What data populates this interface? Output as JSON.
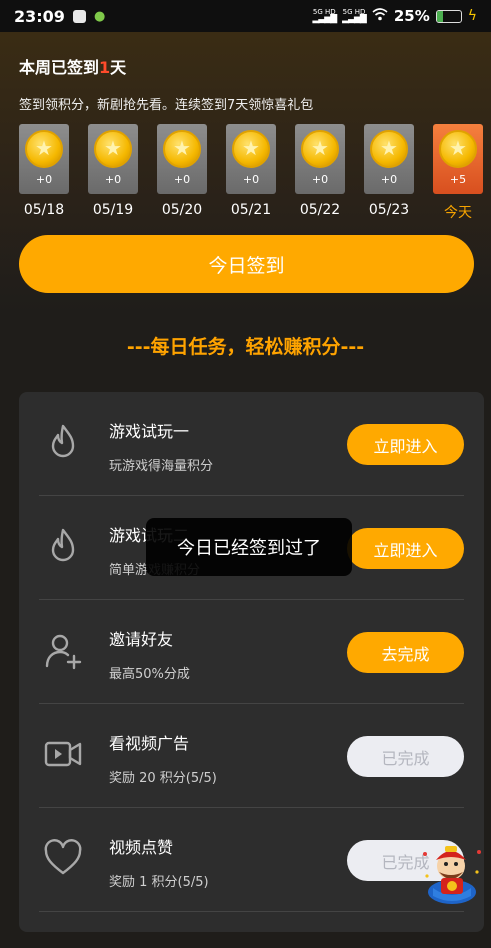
{
  "status_bar": {
    "time": "23:09",
    "signal_1_label": "5G HD",
    "signal_2_label": "5G HD",
    "battery_percent": "25%",
    "battery_level": 0.25
  },
  "week": {
    "title_prefix": "本周已签到",
    "days_count": "1",
    "title_suffix": "天",
    "subtitle": "签到领积分，新剧抢先看。连续签到7天领惊喜礼包"
  },
  "days": [
    {
      "points": "+0",
      "date": "05/18"
    },
    {
      "points": "+0",
      "date": "05/19"
    },
    {
      "points": "+0",
      "date": "05/20"
    },
    {
      "points": "+0",
      "date": "05/21"
    },
    {
      "points": "+0",
      "date": "05/22"
    },
    {
      "points": "+0",
      "date": "05/23"
    },
    {
      "points": "+5",
      "date": "今天"
    }
  ],
  "checkin_button": "今日签到",
  "tasks_heading": "---每日任务，轻松赚积分---",
  "tasks": [
    {
      "icon": "flame-icon",
      "title": "游戏试玩一",
      "desc": "玩游戏得海量积分",
      "button": "立即进入",
      "done": false
    },
    {
      "icon": "flame-icon",
      "title": "游戏试玩二",
      "desc": "简单游戏赚积分",
      "button": "立即进入",
      "done": false
    },
    {
      "icon": "add-user-icon",
      "title": "邀请好友",
      "desc": "最高50%分成",
      "button": "去完成",
      "done": false
    },
    {
      "icon": "video-icon",
      "title": "看视频广告",
      "desc": "奖励 20 积分(5/5)",
      "button": "已完成",
      "done": true
    },
    {
      "icon": "heart-icon",
      "title": "视频点赞",
      "desc": "奖励 1 积分(5/5)",
      "button": "已完成",
      "done": true
    }
  ],
  "toast": "今日已经签到过了"
}
